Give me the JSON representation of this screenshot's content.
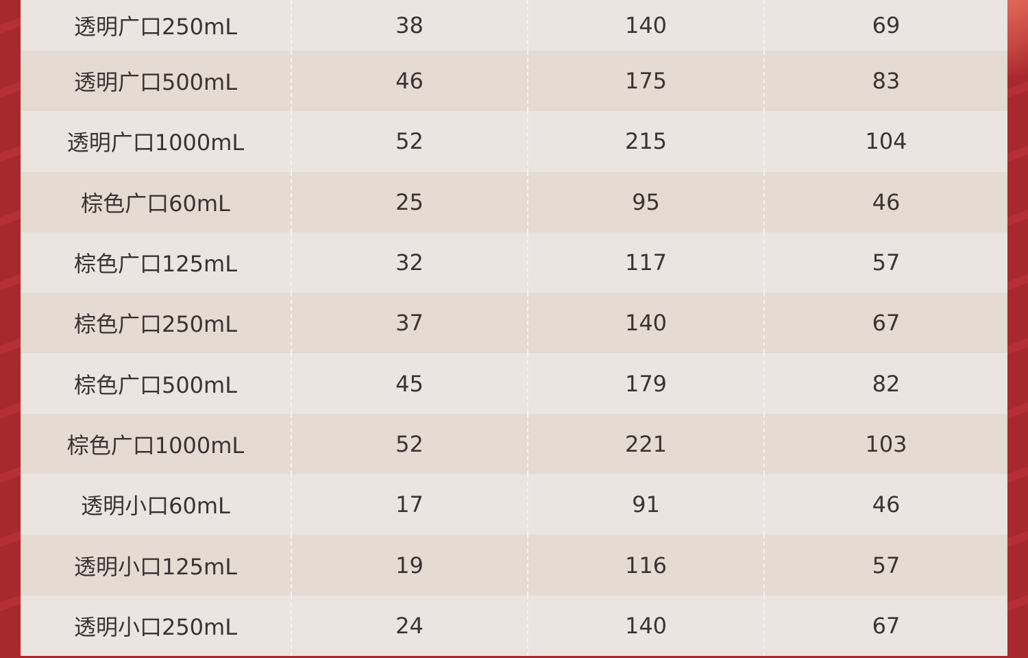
{
  "table": {
    "rows": [
      [
        "透明广口250mL",
        "38",
        "140",
        "69"
      ],
      [
        "透明广口500mL",
        "46",
        "175",
        "83"
      ],
      [
        "透明广口1000mL",
        "52",
        "215",
        "104"
      ],
      [
        "棕色广口60mL",
        "25",
        "95",
        "46"
      ],
      [
        "棕色广口125mL",
        "32",
        "117",
        "57"
      ],
      [
        "棕色广口250mL",
        "37",
        "140",
        "67"
      ],
      [
        "棕色广口500mL",
        "45",
        "179",
        "82"
      ],
      [
        "棕色广口1000mL",
        "52",
        "221",
        "103"
      ],
      [
        "透明小口60mL",
        "17",
        "91",
        "46"
      ],
      [
        "透明小口125mL",
        "19",
        "116",
        "57"
      ],
      [
        "透明小口250mL",
        "24",
        "140",
        "67"
      ]
    ]
  },
  "colors": {
    "frame": "#a8272c",
    "row_light": "#ebe4df",
    "row_dark": "#e5dbd3",
    "text": "#3a3330"
  }
}
